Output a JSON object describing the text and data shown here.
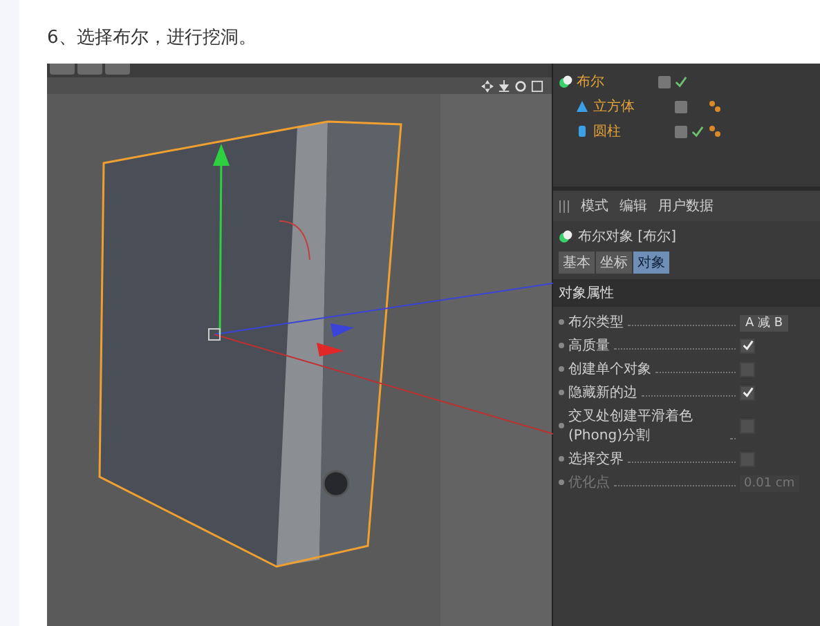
{
  "heading": "6、选择布尔，进行挖洞。",
  "object_manager": {
    "objects": [
      {
        "name": "布尔",
        "kind": "boole",
        "enabled": true,
        "children": [
          {
            "name": "立方体",
            "kind": "cube",
            "enabled": false
          },
          {
            "name": "圆柱",
            "kind": "cylinder",
            "enabled": true
          }
        ]
      }
    ]
  },
  "attributes": {
    "menu": [
      "模式",
      "编辑",
      "用户数据"
    ],
    "object_title": "布尔对象 [布尔]",
    "tabs": [
      {
        "label": "基本",
        "selected": false
      },
      {
        "label": "坐标",
        "selected": false
      },
      {
        "label": "对象",
        "selected": true
      }
    ],
    "section": "对象属性",
    "properties": [
      {
        "kind": "dropdown",
        "label": "布尔类型",
        "value": "A 减 B"
      },
      {
        "kind": "checkbox",
        "label": "高质量",
        "checked": true
      },
      {
        "kind": "checkbox",
        "label": "创建单个对象",
        "checked": false
      },
      {
        "kind": "checkbox",
        "label": "隐藏新的边",
        "checked": true
      },
      {
        "kind": "checkbox",
        "label": "交叉处创建平滑着色(Phong)分割",
        "checked": false
      },
      {
        "kind": "checkbox",
        "label": "选择交界",
        "checked": false
      },
      {
        "kind": "field",
        "label": "优化点",
        "value": "0.01 cm",
        "disabled": true
      }
    ]
  }
}
